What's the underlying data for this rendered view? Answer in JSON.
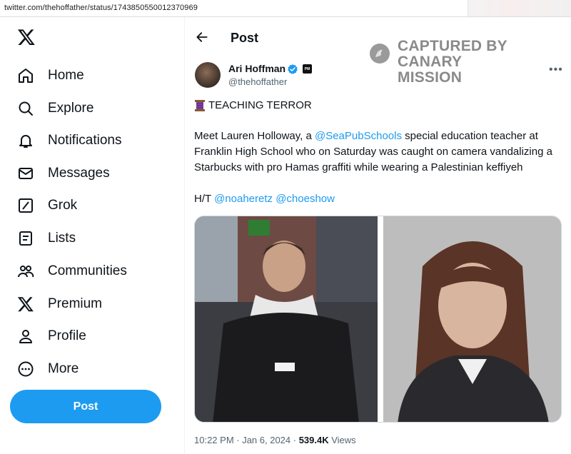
{
  "browser": {
    "url": "twitter.com/thehoffather/status/1743850550012370969"
  },
  "sidebar": {
    "logo": "x-logo-icon",
    "items": [
      {
        "label": "Home",
        "icon": "home-icon"
      },
      {
        "label": "Explore",
        "icon": "search-icon"
      },
      {
        "label": "Notifications",
        "icon": "bell-icon"
      },
      {
        "label": "Messages",
        "icon": "envelope-icon"
      },
      {
        "label": "Grok",
        "icon": "grok-icon"
      },
      {
        "label": "Lists",
        "icon": "list-icon"
      },
      {
        "label": "Communities",
        "icon": "people-icon"
      },
      {
        "label": "Premium",
        "icon": "x-logo-icon"
      },
      {
        "label": "Profile",
        "icon": "person-icon"
      },
      {
        "label": "More",
        "icon": "more-circle-icon"
      }
    ],
    "post_button": "Post"
  },
  "header": {
    "title": "Post"
  },
  "watermark": {
    "line1": "CAPTURED BY",
    "line2": "CANARY MISSION"
  },
  "tweet": {
    "author_name": "Ari Hoffman",
    "affiliate_badge": "PM",
    "handle": "@thehoffather",
    "heading": "TEACHING TERROR",
    "body_pre": "Meet Lauren Holloway, a ",
    "body_mention": "@SeaPubSchools",
    "body_post": " special education teacher at Franklin High School who on Saturday was caught on camera vandalizing a Starbucks with pro Hamas graffiti while wearing a Palestinian keffiyeh",
    "ht_prefix": "H/T ",
    "ht_mention1": "@noaheretz",
    "ht_mention2": "@choeshow",
    "time": "10:22 PM · Jan 6, 2024 · ",
    "views_count": "539.4K",
    "views_label": " Views"
  },
  "colors": {
    "accent": "#1d9bf0",
    "text": "#0f1419",
    "muted": "#536471"
  }
}
